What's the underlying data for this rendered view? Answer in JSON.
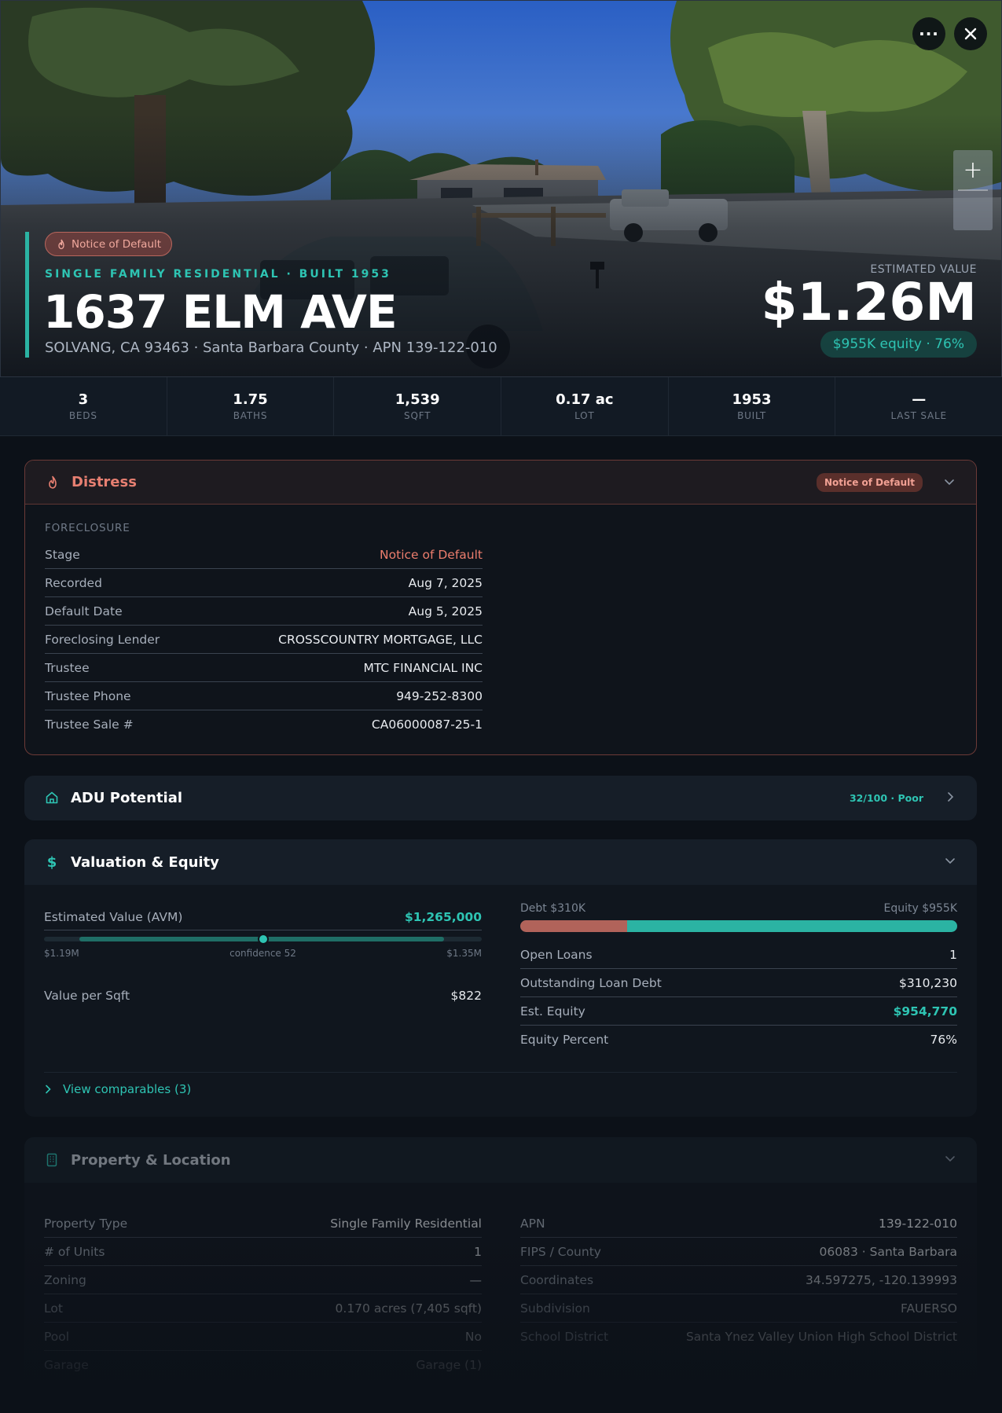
{
  "hero": {
    "distress_pill": "Notice of Default",
    "kicker": "SINGLE FAMILY RESIDENTIAL · BUILT 1953",
    "title": "1637 ELM AVE",
    "subtitle": "SOLVANG, CA 93463 · Santa Barbara County · APN 139-122-010",
    "estimated_label": "ESTIMATED VALUE",
    "estimated_value": "$1.26M",
    "equity_pill": "$955K equity · 76%",
    "buttons": {
      "more": "more-icon",
      "close": "close-icon"
    },
    "zoom": {
      "in": "+",
      "out": "−"
    }
  },
  "stats": [
    {
      "value": "3",
      "label": "BEDS"
    },
    {
      "value": "1.75",
      "label": "BATHS"
    },
    {
      "value": "1,539",
      "label": "SQFT"
    },
    {
      "value": "0.17 ac",
      "label": "LOT"
    },
    {
      "value": "1953",
      "label": "BUILT"
    },
    {
      "value": "—",
      "label": "LAST SALE"
    }
  ],
  "distress": {
    "title": "Distress",
    "badge": "Notice of Default",
    "section_label": "FORECLOSURE",
    "rows": [
      {
        "k": "Stage",
        "v": "Notice of Default"
      },
      {
        "k": "Recorded",
        "v": "Aug 7, 2025"
      },
      {
        "k": "Default Date",
        "v": "Aug 5, 2025"
      },
      {
        "k": "Foreclosing Lender",
        "v": "CROSSCOUNTRY MORTGAGE, LLC"
      },
      {
        "k": "Trustee",
        "v": "MTC FINANCIAL INC"
      },
      {
        "k": "Trustee Phone",
        "v": "949-252-8300"
      },
      {
        "k": "Trustee Sale #",
        "v": "CA06000087-25-1"
      }
    ]
  },
  "adu": {
    "title": "ADU Potential",
    "badge": "32/100 · Poor"
  },
  "valuation": {
    "title": "Valuation & Equity",
    "avm_label": "Estimated Value (AVM)",
    "avm_value": "$1,265,000",
    "avm_low": "$1.19M",
    "avm_confidence": "confidence 52",
    "avm_high": "$1.35M",
    "avm_position": 0.5,
    "value_per_sqft_label": "Value per Sqft",
    "value_per_sqft": "$822",
    "debt_label": "Debt $310K",
    "equity_label": "Equity $955K",
    "debt_fraction": 0.245,
    "rows": [
      {
        "k": "Open Loans",
        "v": "1"
      },
      {
        "k": "Outstanding Loan Debt",
        "v": "$310,230"
      },
      {
        "k": "Est. Equity",
        "v": "$954,770"
      },
      {
        "k": "Equity Percent",
        "v": "76%"
      }
    ],
    "comparables_link": "View comparables (3)"
  },
  "property": {
    "title": "Property & Location",
    "left_rows": [
      {
        "k": "Property Type",
        "v": "Single Family Residential"
      },
      {
        "k": "# of Units",
        "v": "1"
      },
      {
        "k": "Zoning",
        "v": "—"
      },
      {
        "k": "Lot",
        "v": "0.170 acres (7,405 sqft)"
      },
      {
        "k": "Pool",
        "v": "No"
      },
      {
        "k": "Garage",
        "v": "Garage (1)"
      }
    ],
    "right_rows": [
      {
        "k": "APN",
        "v": "139-122-010"
      },
      {
        "k": "FIPS / County",
        "v": "06083 · Santa Barbara"
      },
      {
        "k": "Coordinates",
        "v": "34.597275, -120.139993"
      },
      {
        "k": "Subdivision",
        "v": "FAUERSO"
      },
      {
        "k": "School District",
        "v": "Santa Ynez Valley Union High School District"
      }
    ]
  },
  "colors": {
    "accent": "#2ec4b3",
    "distress": "#e77f71",
    "background": "#0c1118"
  }
}
